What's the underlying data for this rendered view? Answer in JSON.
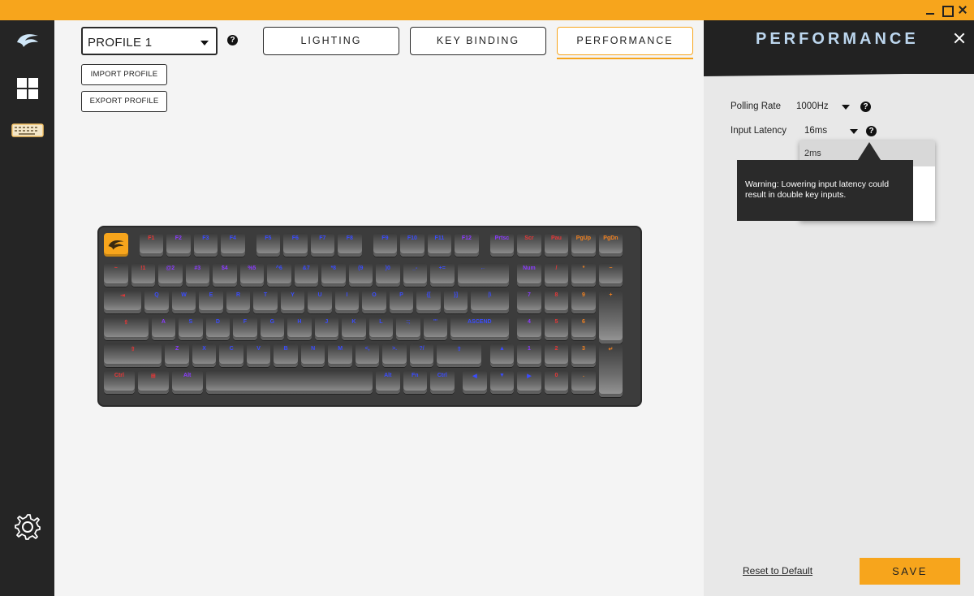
{
  "sidebar": {
    "items": [
      {
        "name": "logo",
        "icon": "glorious-logo-icon"
      },
      {
        "name": "dashboard",
        "icon": "grid-icon"
      },
      {
        "name": "keyboard",
        "icon": "keyboard-icon"
      },
      {
        "name": "settings",
        "icon": "gear-icon"
      }
    ]
  },
  "profile": {
    "selected": "PROFILE 1",
    "help": "?",
    "import_label": "IMPORT PROFILE",
    "export_label": "EXPORT PROFILE"
  },
  "tabs": [
    {
      "label": "LIGHTING"
    },
    {
      "label": "KEY BINDING"
    },
    {
      "label": "PERFORMANCE"
    }
  ],
  "active_tab": "PERFORMANCE",
  "keyboard": {
    "row0": [
      "",
      "F1",
      "F2",
      "F3",
      "F4",
      "F5",
      "F6",
      "F7",
      "F8",
      "F9",
      "F10",
      "F11",
      "F12",
      "Prtsc",
      "Scr",
      "Pau",
      "PgUp",
      "PgDn"
    ],
    "row1": [
      "~",
      "!1",
      "@2",
      "#3",
      "$4",
      "%5",
      "^6",
      "&7",
      "*8",
      "(9",
      ")0",
      "_-",
      "+=",
      "←",
      "Num",
      "/",
      "*",
      "−"
    ],
    "row2": [
      "⇥",
      "Q",
      "W",
      "E",
      "R",
      "T",
      "Y",
      "U",
      "I",
      "O",
      "P",
      "{[",
      "}]",
      "|\\",
      "7",
      "8",
      "9",
      "+"
    ],
    "row3": [
      "⇪",
      "A",
      "S",
      "D",
      "F",
      "G",
      "H",
      "J",
      "K",
      "L",
      ":;",
      "\"'",
      "ASCEND",
      "4",
      "5",
      "6"
    ],
    "row4": [
      "⇧",
      "Z",
      "X",
      "C",
      "V",
      "B",
      "N",
      "M",
      "<,",
      ">.",
      "?/",
      "⇧",
      "▲",
      "1",
      "2",
      "3",
      "↵"
    ],
    "row5": [
      "Ctrl",
      "⊞",
      "Alt",
      "",
      "Alt",
      "Fn",
      "Ctrl",
      "◀",
      "▼",
      "▶",
      "0",
      "."
    ]
  },
  "panel": {
    "title": "PERFORMANCE",
    "polling_rate_label": "Polling Rate",
    "polling_rate_value": "1000Hz",
    "input_latency_label": "Input Latency",
    "input_latency_value": "16ms",
    "dropdown_option": "2ms",
    "tooltip": "Warning: Lowering input latency could result in double key inputs.",
    "reset_label": "Reset to Default",
    "save_label": "SAVE"
  },
  "colors": {
    "accent": "#f7a51c",
    "sidebar": "#252525",
    "panel_head": "#222222",
    "key_red": "#e83737",
    "key_blue": "#3a4cff",
    "key_purple": "#8b3bff",
    "key_orange": "#f08020"
  }
}
